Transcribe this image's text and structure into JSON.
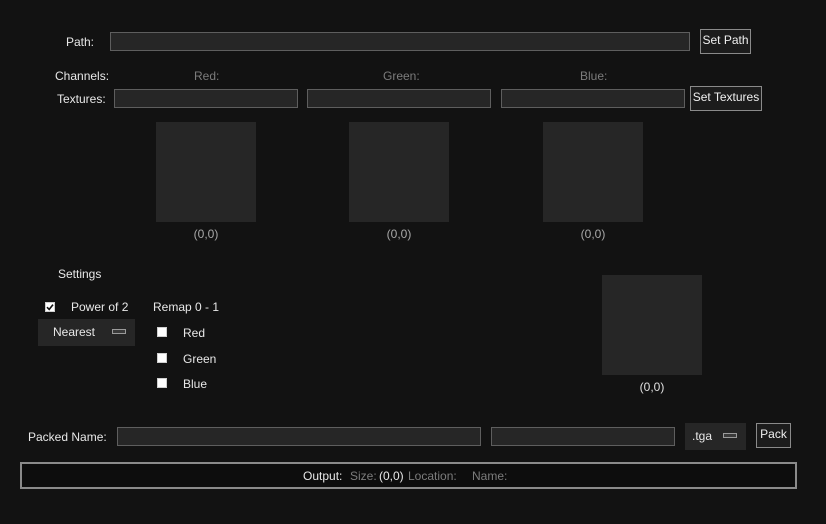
{
  "path": {
    "label": "Path:",
    "value": "",
    "button": "Set Path"
  },
  "channels": {
    "label": "Channels:",
    "red": "Red:",
    "green": "Green:",
    "blue": "Blue:"
  },
  "textures": {
    "label": "Textures:",
    "red_value": "",
    "green_value": "",
    "blue_value": "",
    "button": "Set Textures"
  },
  "previews": {
    "red_coords": "(0,0)",
    "green_coords": "(0,0)",
    "blue_coords": "(0,0)",
    "packed_coords": "(0,0)"
  },
  "settings": {
    "title": "Settings",
    "power_of_2": {
      "label": "Power of 2",
      "checked": true
    },
    "filter": {
      "selected": "Nearest"
    },
    "remap": {
      "title": "Remap 0 - 1",
      "red": {
        "label": "Red",
        "checked": false
      },
      "green": {
        "label": "Green",
        "checked": false
      },
      "blue": {
        "label": "Blue",
        "checked": false
      }
    }
  },
  "packed": {
    "label": "Packed Name:",
    "name_value": "",
    "suffix_value": "",
    "format": ".tga",
    "button": "Pack"
  },
  "output": {
    "label": "Output:",
    "size_label": "Size:",
    "size_value": "(0,0)",
    "location_label": "Location:",
    "location_value": "",
    "name_label": "Name:",
    "name_value": ""
  },
  "colors": {
    "background": "#121212",
    "field": "#262626",
    "border": "#5e5e5e",
    "text": "#e8e8e8",
    "dim_text": "#7c7c7c"
  }
}
